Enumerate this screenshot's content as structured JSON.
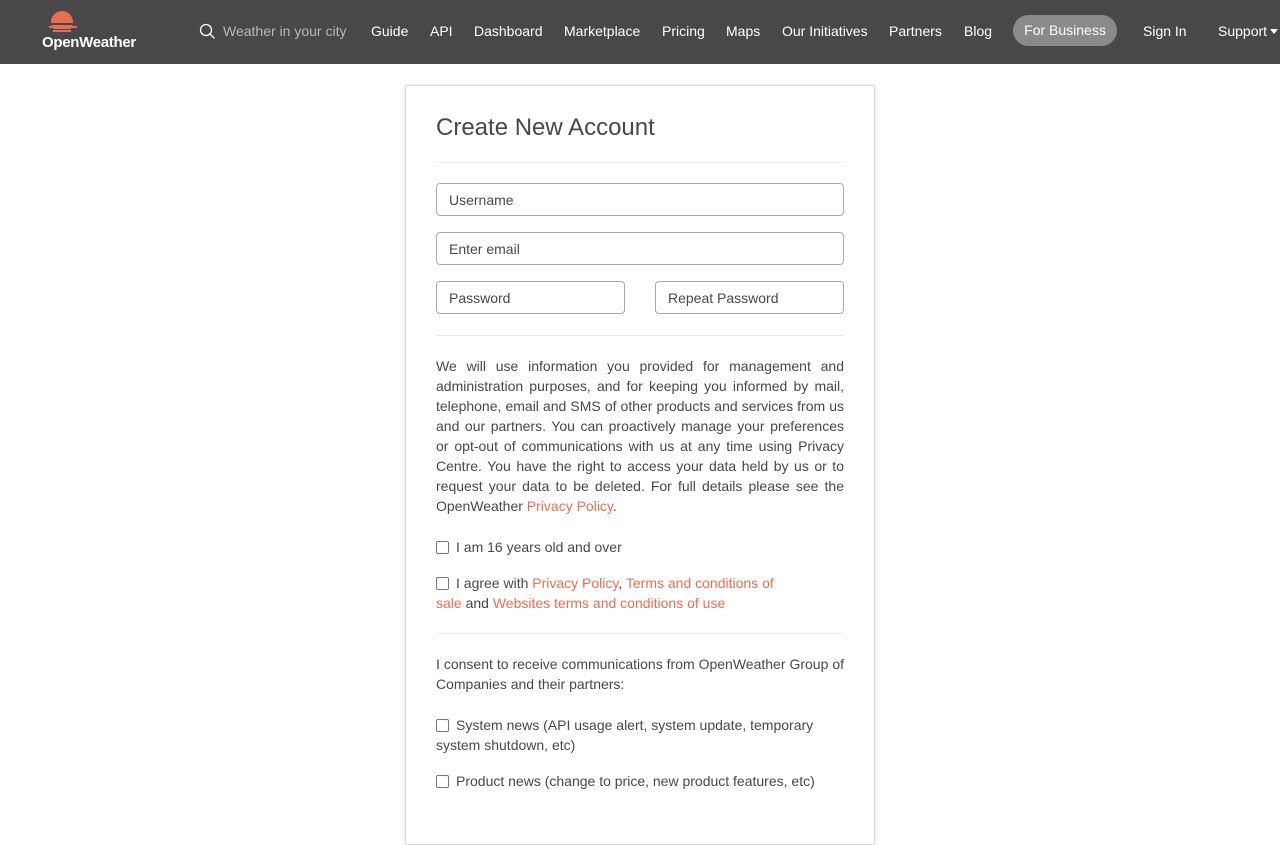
{
  "header": {
    "logo_text": "OpenWeather",
    "search_placeholder": "Weather in your city",
    "nav": {
      "guide": "Guide",
      "api": "API",
      "dashboard": "Dashboard",
      "marketplace": "Marketplace",
      "pricing": "Pricing",
      "maps": "Maps",
      "initiatives": "Our Initiatives",
      "partners": "Partners",
      "blog": "Blog",
      "business": "For Business",
      "signin": "Sign In",
      "support": "Support"
    }
  },
  "form": {
    "title": "Create New Account",
    "username_placeholder": "Username",
    "email_placeholder": "Enter email",
    "password_placeholder": "Password",
    "repeat_password_placeholder": "Repeat Password",
    "notice_text": "We will use information you provided for management and administration purposes, and for keeping you informed by mail, telephone, email and SMS of other products and services from us and our partners. You can proactively manage your preferences or opt-out of communications with us at any time using Privacy Centre. You have the right to access your data held by us or to request your data to be deleted. For full details please see the OpenWeather ",
    "notice_link": "Privacy Policy",
    "notice_end": ".",
    "age_label": "I am 16 years old and over",
    "agree_prefix": "I agree with ",
    "agree_privacy": "Privacy Policy",
    "agree_comma": ", ",
    "agree_terms_sale": "Terms and conditions of sale",
    "agree_and": " and ",
    "agree_terms_web": "Websites terms and conditions of use",
    "consent_text": "I consent to receive communications from OpenWeather Group of Companies and their partners:",
    "system_news": "System news (API usage alert, system update, temporary system shutdown, etc)",
    "product_news": "Product news (change to price, new product features, etc)"
  },
  "colors": {
    "header_bg": "#48484a",
    "accent": "#e96e50",
    "business_pill": "#8a8a8d"
  }
}
